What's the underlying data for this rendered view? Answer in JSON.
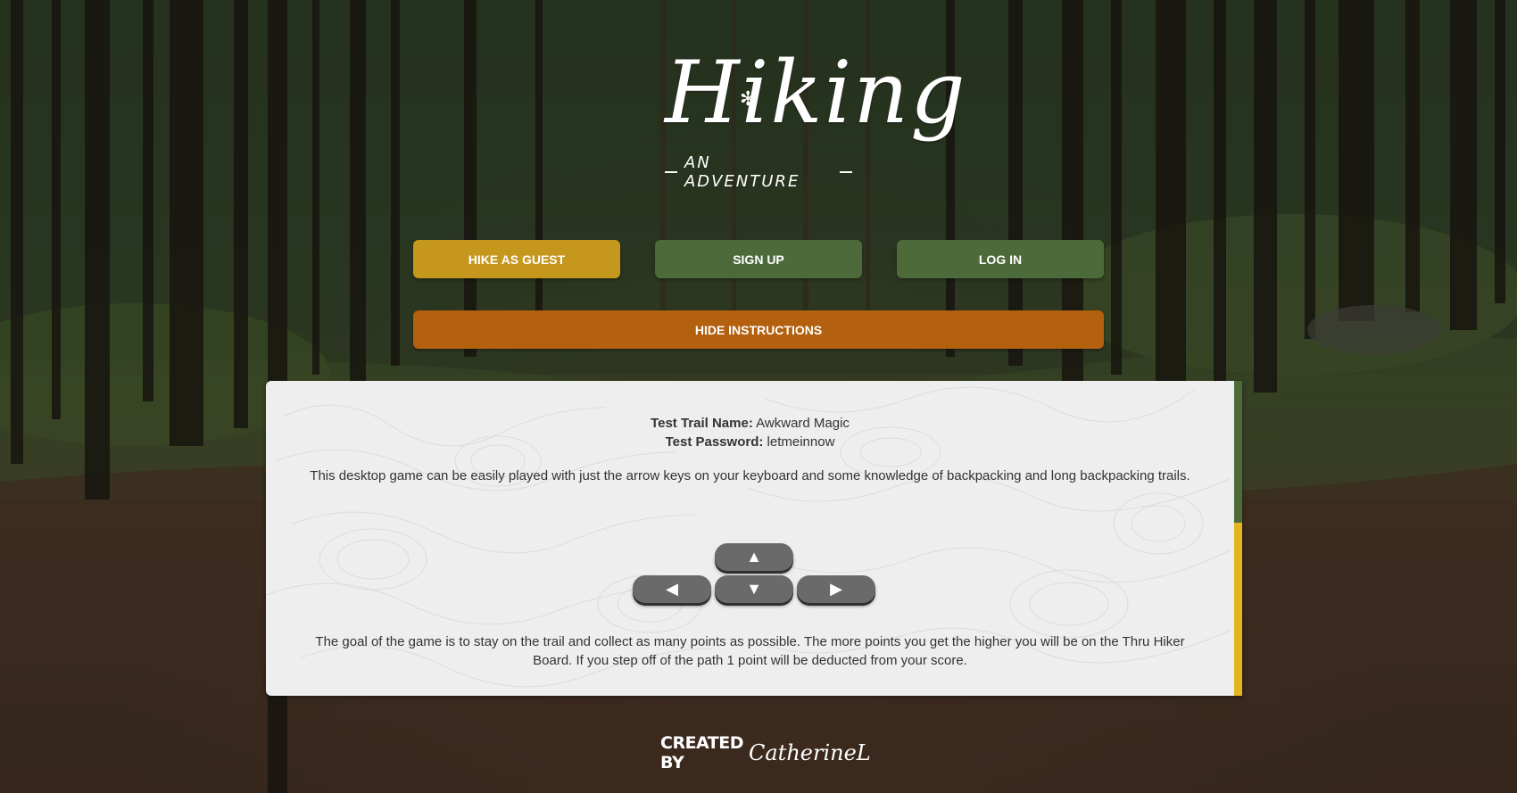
{
  "logo": {
    "title": "Hiking",
    "subtitle": "AN ADVENTURE"
  },
  "buttons": {
    "guest": "HIKE AS GUEST",
    "signup": "SIGN UP",
    "login": "LOG IN",
    "hide_instructions": "HIDE INSTRUCTIONS"
  },
  "instructions": {
    "trail_name_label": "Test Trail Name:",
    "trail_name_value": "Awkward Magic",
    "password_label": "Test Password:",
    "password_value": "letmeinnow",
    "paragraph_1": "This desktop game can be easily played with just the arrow keys on your keyboard and some knowledge of backpacking and long backpacking trails.",
    "paragraph_2": "The goal of the game is to stay on the trail and collect as many points as possible. The more points you get the higher you will be on the Thru Hiker Board. If you step off of the path 1 point will be deducted from your score.",
    "keys": {
      "up": "▲",
      "left": "◀",
      "down": "▼",
      "right": "▶"
    }
  },
  "footer": {
    "label": "CREATED BY",
    "signature": "CatherineL"
  },
  "colors": {
    "guest": "#c5971d",
    "signup": "#4d6b3a",
    "login": "#4d6b3a",
    "hide": "#b3600f",
    "panel_bar_top": "#4d6b3a",
    "panel_bar_bottom": "#e3b51e"
  }
}
